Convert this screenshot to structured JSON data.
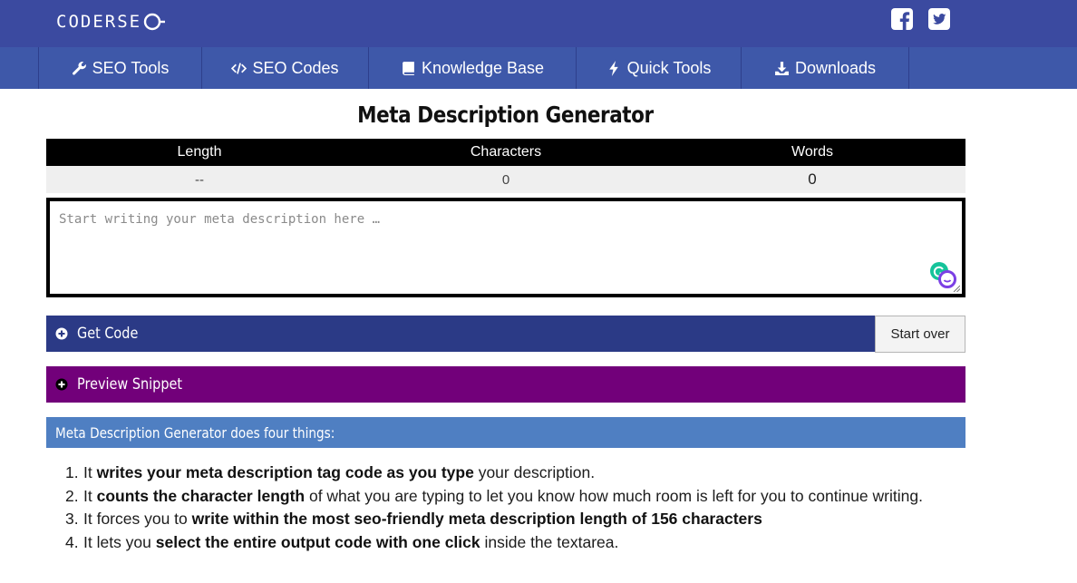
{
  "header": {
    "logo_text": "CODERSE",
    "social": [
      "facebook-icon",
      "twitter-icon"
    ],
    "brand_color": "#3b4aa0"
  },
  "nav": {
    "items": [
      {
        "label": "SEO Tools",
        "icon": "wrench-icon"
      },
      {
        "label": "SEO Codes",
        "icon": "code-icon"
      },
      {
        "label": "Knowledge Base",
        "icon": "book-icon"
      },
      {
        "label": "Quick Tools",
        "icon": "bolt-icon"
      },
      {
        "label": "Downloads",
        "icon": "download-icon"
      }
    ]
  },
  "main": {
    "title": "Meta Description Generator",
    "stats": {
      "headers": [
        "Length",
        "Characters",
        "Words"
      ],
      "values": [
        "--",
        "0",
        "0"
      ]
    },
    "editor": {
      "value": "",
      "placeholder": "Start writing your meta description here …"
    },
    "get_code": {
      "label": "Get Code",
      "color": "#2b3a86"
    },
    "start_over": {
      "label": "Start over"
    },
    "preview": {
      "label": "Preview Snippet",
      "color": "#72007a"
    },
    "info": {
      "heading": "Meta Description Generator does four things:",
      "items": [
        {
          "pre": "It ",
          "bold": "writes your meta description tag code as you type",
          "post": " your description."
        },
        {
          "pre": "It ",
          "bold": "counts the character length",
          "post": " of what you are typing to let you know how much room is left for you to continue writing."
        },
        {
          "pre": "It forces you to ",
          "bold": "write within the most seo-friendly meta description length of 156 characters",
          "post": ""
        },
        {
          "pre": "It lets you ",
          "bold": "select the entire output code with one click",
          "post": " inside the textarea."
        }
      ]
    }
  }
}
